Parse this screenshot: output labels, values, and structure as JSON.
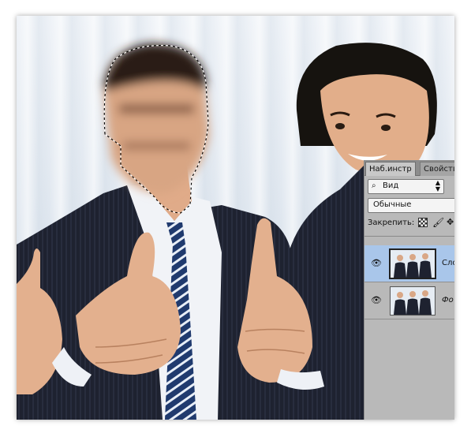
{
  "panel": {
    "tabs": [
      {
        "label": "Наб.инстр"
      },
      {
        "label": "Свойства"
      }
    ],
    "filter": {
      "label": "Вид"
    },
    "blend_mode": "Обычные",
    "lock_label": "Закрепить:",
    "layers": [
      {
        "name": "Сло",
        "selected": true
      },
      {
        "name": "Фо",
        "selected": false
      }
    ]
  },
  "colors": {
    "panel_bg": "#b9b9b9",
    "selected_layer": "#a9c6ea",
    "suit": "#1e2230",
    "skin": "#e3b08e"
  },
  "icons": [
    "search-icon",
    "sort-arrows-icon",
    "lock-transparency-icon",
    "brush-icon",
    "move-icon",
    "eye-icon"
  ]
}
